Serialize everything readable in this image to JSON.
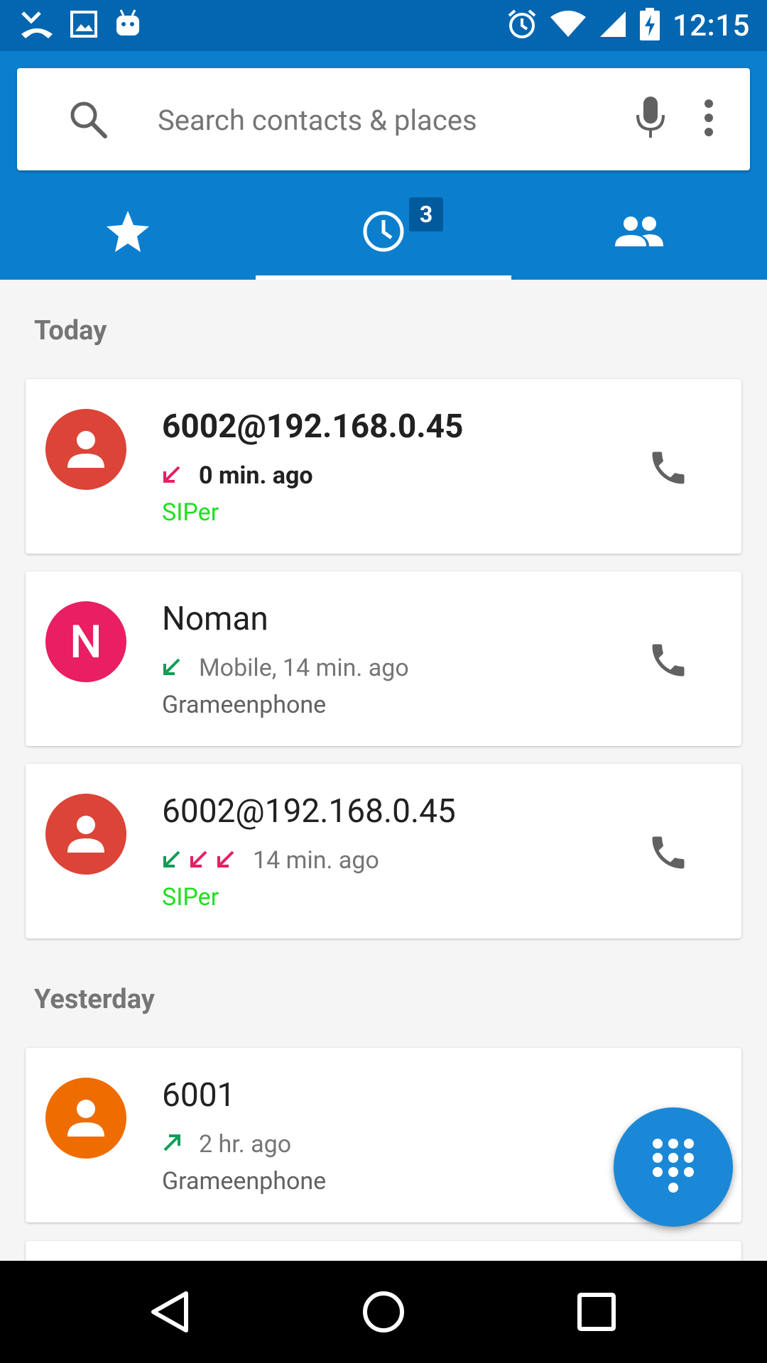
{
  "status_bar": {
    "time": "12:15",
    "left_icons": [
      "missed-call-icon",
      "image-icon",
      "android-icon"
    ],
    "right_icons": [
      "alarm-icon",
      "wifi-icon",
      "signal-icon",
      "battery-charging-icon"
    ]
  },
  "search": {
    "placeholder": "Search contacts & places"
  },
  "tabs": [
    {
      "name": "favorites",
      "icon": "star-icon",
      "selected": false
    },
    {
      "name": "recents",
      "icon": "clock-icon",
      "selected": true,
      "badge": "3"
    },
    {
      "name": "contacts",
      "icon": "people-icon",
      "selected": false
    }
  ],
  "sections": {
    "today": "Today",
    "yesterday": "Yesterday"
  },
  "calls": [
    {
      "name": "6002@192.168.0.45",
      "detail": "0 min. ago",
      "label": "SIPer",
      "avatar_color": "#db4437",
      "arrows": [
        "missed"
      ],
      "unread": true
    },
    {
      "name": "Noman",
      "detail": "Mobile, 14 min. ago",
      "label": "Grameenphone",
      "avatar_letter": "N",
      "avatar_color": "#e91e63",
      "arrows": [
        "incoming"
      ]
    },
    {
      "name": "6002@192.168.0.45",
      "detail": "14 min. ago",
      "label": "SIPer",
      "avatar_color": "#db4437",
      "arrows": [
        "incoming",
        "missed",
        "missed"
      ]
    },
    {
      "name": "6001",
      "detail": "2 hr. ago",
      "label": "Grameenphone",
      "avatar_color": "#ef6c00",
      "arrows": [
        "outgoing"
      ]
    }
  ],
  "colors": {
    "status_bar": "#0466b0",
    "app_bar": "#0b7fce",
    "fab": "#1a88d6",
    "siper_green": "#1ee01e",
    "missed_red": "#e91e63",
    "incoming_green": "#0f9d58"
  }
}
